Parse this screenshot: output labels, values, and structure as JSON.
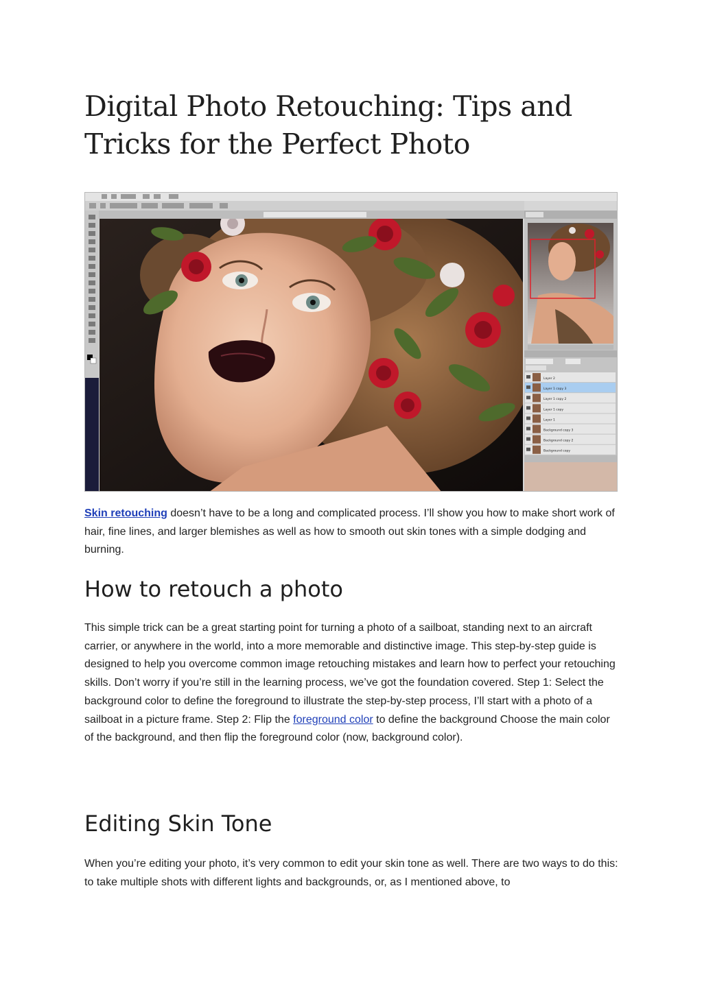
{
  "article": {
    "title": "Digital Photo Retouching: Tips and Tricks for the Perfect Photo",
    "intro": {
      "link": "Skin retouching",
      "text": " doesn’t have to be a long and complicated process. I’ll show you how to make short work of hair, fine lines, and larger blemishes as well as how to smooth out skin tones with a simple dodging and burning."
    },
    "section1": {
      "heading": "How to retouch a photo",
      "text_before_link": "This simple trick can be a great starting point for turning a photo of a sailboat, standing next to an aircraft carrier, or anywhere in the world, into a more memorable and distinctive image. This step-by-step guide is designed to help you overcome common image retouching mistakes and learn how to perfect your retouching skills. Don’t worry if you’re still in the learning process, we’ve got the foundation covered. Step 1: Select the background color to define the foreground to illustrate the step-by-step process, I’ll start with a photo of a sailboat in a picture frame. Step 2: Flip the ",
      "link": "foreground color",
      "text_after_link": " to define the background Choose the main color of the background, and then flip the foreground color (now, background color)."
    },
    "section2": {
      "heading": "Editing Skin Tone",
      "text": "When you’re editing your photo, it’s very common to edit your skin tone as well. There are two ways to do this: to take multiple shots with different lights and backgrounds, or, as I mentioned above, to"
    }
  },
  "screenshot": {
    "layers": [
      "Layer 2",
      "Layer 1 copy 3",
      "Layer 1 copy 2",
      "Layer 1 copy",
      "Layer 1",
      "Background copy 3",
      "Background copy 2",
      "Background copy"
    ],
    "selected_layer": 1,
    "colors": {
      "ui_gray": "#d6d6d6",
      "background_dark": "#1a1412",
      "skin": "#e6b79a",
      "lips": "#2a0c10",
      "rose": "#c0182a",
      "leaf": "#4e6a2c",
      "selection": "#a9cdf0"
    }
  }
}
